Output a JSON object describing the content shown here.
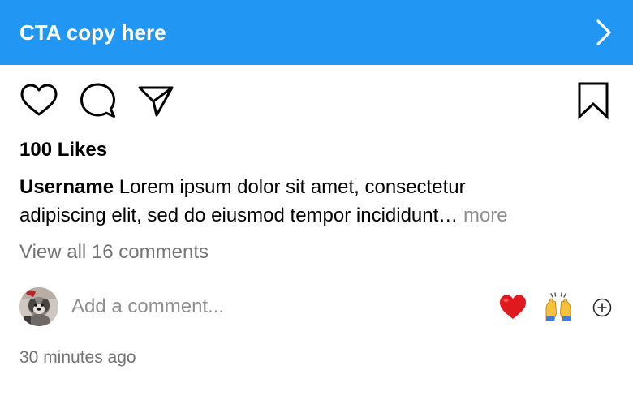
{
  "cta": {
    "label": "CTA copy here",
    "color": "#2196F3",
    "icon": "chevron-right-icon"
  },
  "actions": {
    "icons": [
      "heart-icon",
      "comment-icon",
      "share-icon",
      "bookmark-icon"
    ]
  },
  "likes": {
    "label": "100 Likes"
  },
  "caption": {
    "username": "Username",
    "line1_text": " Lorem ipsum dolor sit amet, consectetur",
    "line2_text": "adipiscing elit, sed do eiusmod tempor incididunt… ",
    "more_label": "more"
  },
  "comments": {
    "view_all_label": "View all 16 comments"
  },
  "composer": {
    "placeholder": "Add a comment...",
    "value": "",
    "quick_reactions": [
      "red-heart-emoji-icon",
      "raised-hands-emoji-icon"
    ],
    "add_icon": "plus-circle-icon"
  },
  "post": {
    "timestamp": "30 minutes ago"
  }
}
